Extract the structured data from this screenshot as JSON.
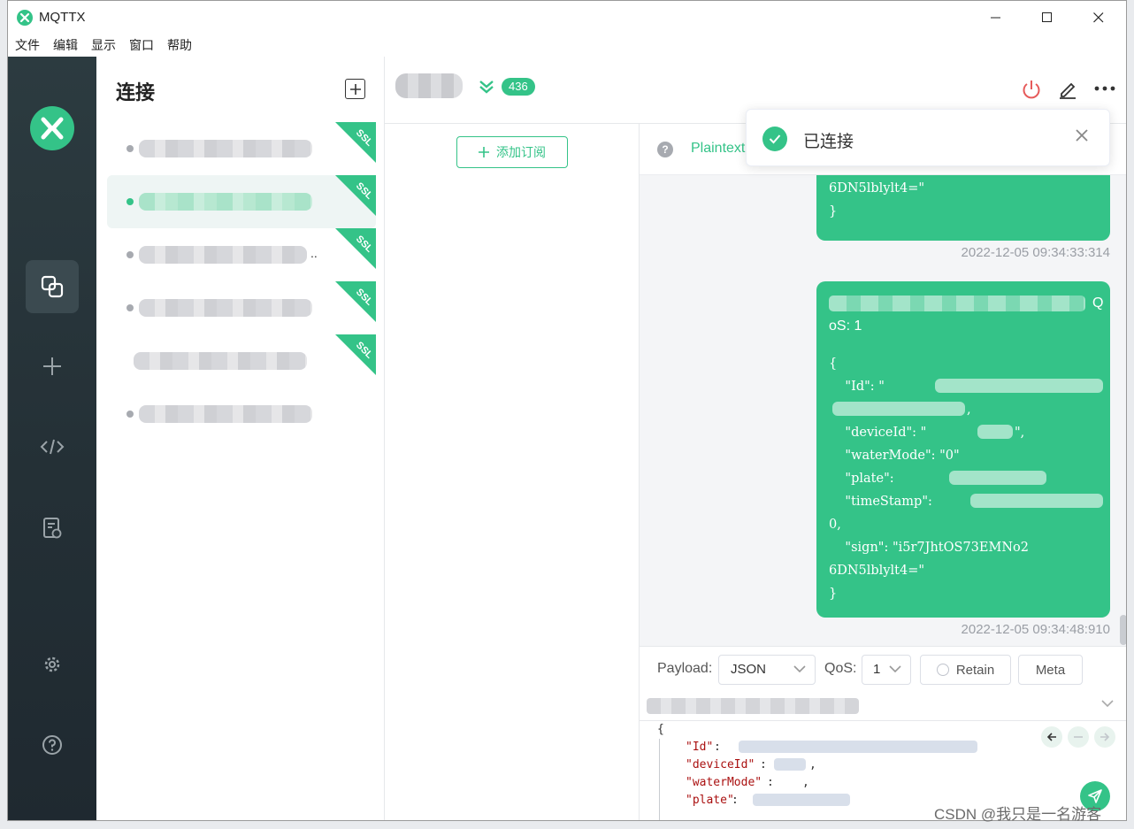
{
  "window": {
    "app_title": "MQTTX"
  },
  "menu": [
    "文件",
    "编辑",
    "显示",
    "窗口",
    "帮助"
  ],
  "sidebar": {
    "title": "连接",
    "connections": [
      {
        "ssl": "SSL",
        "active": false
      },
      {
        "ssl": "SSL",
        "active": true
      },
      {
        "ssl": "SSL",
        "active": false,
        "suffix": ".."
      },
      {
        "ssl": "SSL",
        "active": false
      },
      {
        "ssl": "SSL",
        "active": false
      },
      {
        "active": false
      }
    ]
  },
  "header": {
    "message_count": "436"
  },
  "subscriptions": {
    "add_label": "添加订阅"
  },
  "messages": {
    "format_label": "Plaintext",
    "items": [
      {
        "lines": [
          "6DN5lblylt4=\"",
          "}"
        ],
        "timestamp": "2022-12-05 09:34:33:314"
      },
      {
        "line_qos_tail": "Q",
        "line_qos": "oS: 1",
        "lines": [
          "{",
          "    \"Id\": \"",
          ",",
          "    \"deviceId\": \"",
          "\",",
          "    \"waterMode\": \"0\"",
          "    \"plate\":",
          "    \"timeStamp\":",
          "0,",
          "    \"sign\": \"i5r7JhtOS73EMNo2",
          "6DN5lblylt4=\"",
          "}"
        ],
        "timestamp": "2022-12-05 09:34:48:910"
      }
    ]
  },
  "publish": {
    "payload_label": "Payload:",
    "payload_value": "JSON",
    "qos_label": "QoS:",
    "qos_value": "1",
    "retain_label": "Retain",
    "meta_label": "Meta",
    "editor": {
      "open": "{",
      "k_id": "\"Id\"",
      "k_device": "\"deviceId\"",
      "k_water": "\"waterMode\"",
      "k_plate": "\"plate\"",
      "colon": ":",
      "comma": ","
    }
  },
  "toast": {
    "message": "已连接"
  },
  "watermark": "CSDN @我只是一名游客",
  "colors": {
    "accent": "#34c388",
    "rail": "#263238",
    "danger": "#e65a5a"
  }
}
